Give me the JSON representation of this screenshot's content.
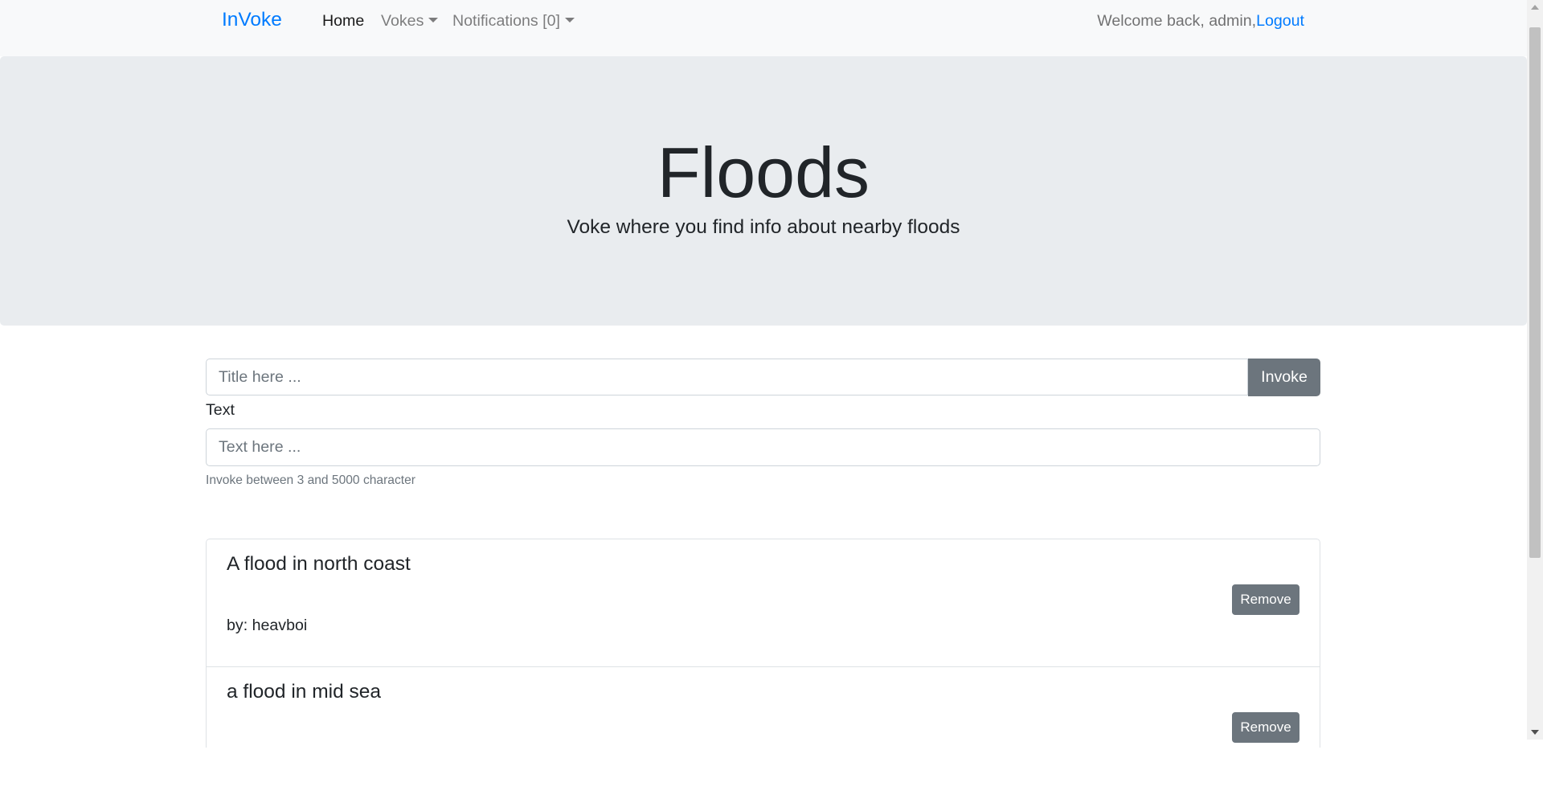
{
  "navbar": {
    "brand": "InVoke",
    "links": [
      {
        "label": "Home"
      },
      {
        "label": "Vokes"
      },
      {
        "label": "Notifications [0]"
      }
    ],
    "welcome_text": "Welcome back, admin,",
    "logout_label": "Logout"
  },
  "hero": {
    "title": "Floods",
    "subtitle": "Voke where you find info about nearby floods"
  },
  "form": {
    "title_placeholder": "Title here ...",
    "invoke_label": "Invoke",
    "text_label": "Text",
    "text_placeholder": "Text here ...",
    "help_text": "Invoke between 3 and 5000 character"
  },
  "vokes": [
    {
      "title": "A flood in north coast",
      "author": "by: heavboi",
      "remove_label": "Remove"
    },
    {
      "title": "a flood in mid sea",
      "author": "",
      "remove_label": "Remove"
    }
  ]
}
